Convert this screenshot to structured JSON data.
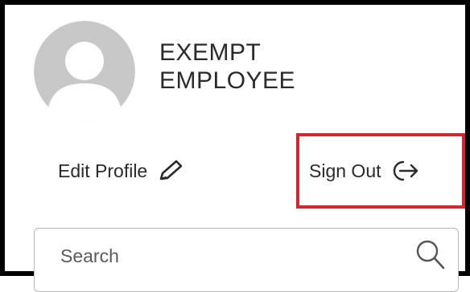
{
  "profile": {
    "name_line1": "EXEMPT",
    "name_line2": "EMPLOYEE",
    "avatar_icon": "default-user-avatar-icon"
  },
  "actions": {
    "edit_profile_label": "Edit Profile",
    "edit_profile_icon": "pencil-icon",
    "sign_out_label": "Sign Out",
    "sign_out_icon": "sign-out-arrow-icon"
  },
  "highlight": {
    "color": "#d2252e",
    "target": "sign-out-button"
  },
  "search": {
    "placeholder": "Search",
    "value": "",
    "icon": "search-icon"
  }
}
